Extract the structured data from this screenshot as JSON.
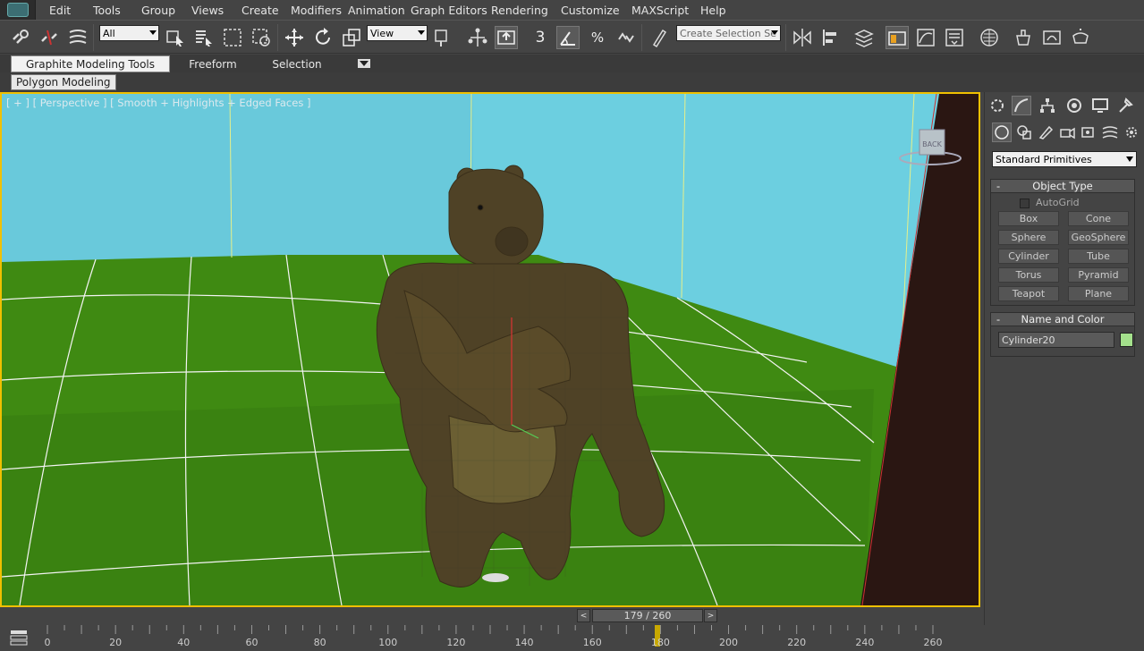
{
  "menu": {
    "items": [
      "Edit",
      "Tools",
      "Group",
      "Views",
      "Create",
      "Modifiers",
      "Animation",
      "Graph Editors",
      "Rendering",
      "Customize",
      "MAXScript",
      "Help"
    ]
  },
  "toolbar": {
    "selection_filter": "All",
    "reference_coord": "View",
    "selection_set_placeholder": "Create Selection Se",
    "snap_label": "3",
    "icons": [
      "select-and-link-icon",
      "unlink-icon",
      "bind-space-warp-icon",
      "select-object-icon",
      "select-by-name-icon",
      "rectangle-selection-icon",
      "window-crossing-icon",
      "select-and-move-icon",
      "select-and-rotate-icon",
      "select-and-scale-icon",
      "use-pivot-icon",
      "select-and-manipulate-icon",
      "keyboard-shortcut-icon",
      "snap-toggle-icon",
      "angle-snap-icon",
      "percent-snap-icon",
      "spinner-snap-icon",
      "edit-named-selection-icon",
      "mirror-icon",
      "align-icon",
      "layer-manager-icon",
      "graphite-toggle-icon",
      "curve-editor-icon",
      "schematic-view-icon",
      "material-editor-icon",
      "render-setup-icon",
      "rendered-frame-icon",
      "render-icon"
    ]
  },
  "ribbon": {
    "tabs": [
      "Graphite Modeling Tools",
      "Freeform",
      "Selection"
    ],
    "active_panel": "Polygon Modeling"
  },
  "viewport": {
    "label": "[ + ] [ Perspective ] [ Smooth + Highlights + Edged Faces ]",
    "viewcube_text": "BACK"
  },
  "command_panel": {
    "category": "Standard Primitives",
    "object_type_title": "Object Type",
    "autogrid_label": "AutoGrid",
    "primitives": [
      "Box",
      "Cone",
      "Sphere",
      "GeoSphere",
      "Cylinder",
      "Tube",
      "Torus",
      "Pyramid",
      "Teapot",
      "Plane"
    ],
    "name_color_title": "Name and Color",
    "object_name": "Cylinder20",
    "object_color": "#a4e08c",
    "rollout_minus": "-"
  },
  "timeline": {
    "frame_counter": "179 / 260",
    "prev": "<",
    "next": ">",
    "current_frame": 179,
    "total_frames": 260,
    "ticks": [
      "0",
      "20",
      "40",
      "60",
      "80",
      "100",
      "120",
      "140",
      "160",
      "180",
      "200",
      "220",
      "240",
      "260"
    ]
  },
  "colors": {
    "viewport_border": "#f0c000",
    "sky": "#6ccfe0",
    "ground": "#3f8a12",
    "bear": "#4f4226"
  }
}
